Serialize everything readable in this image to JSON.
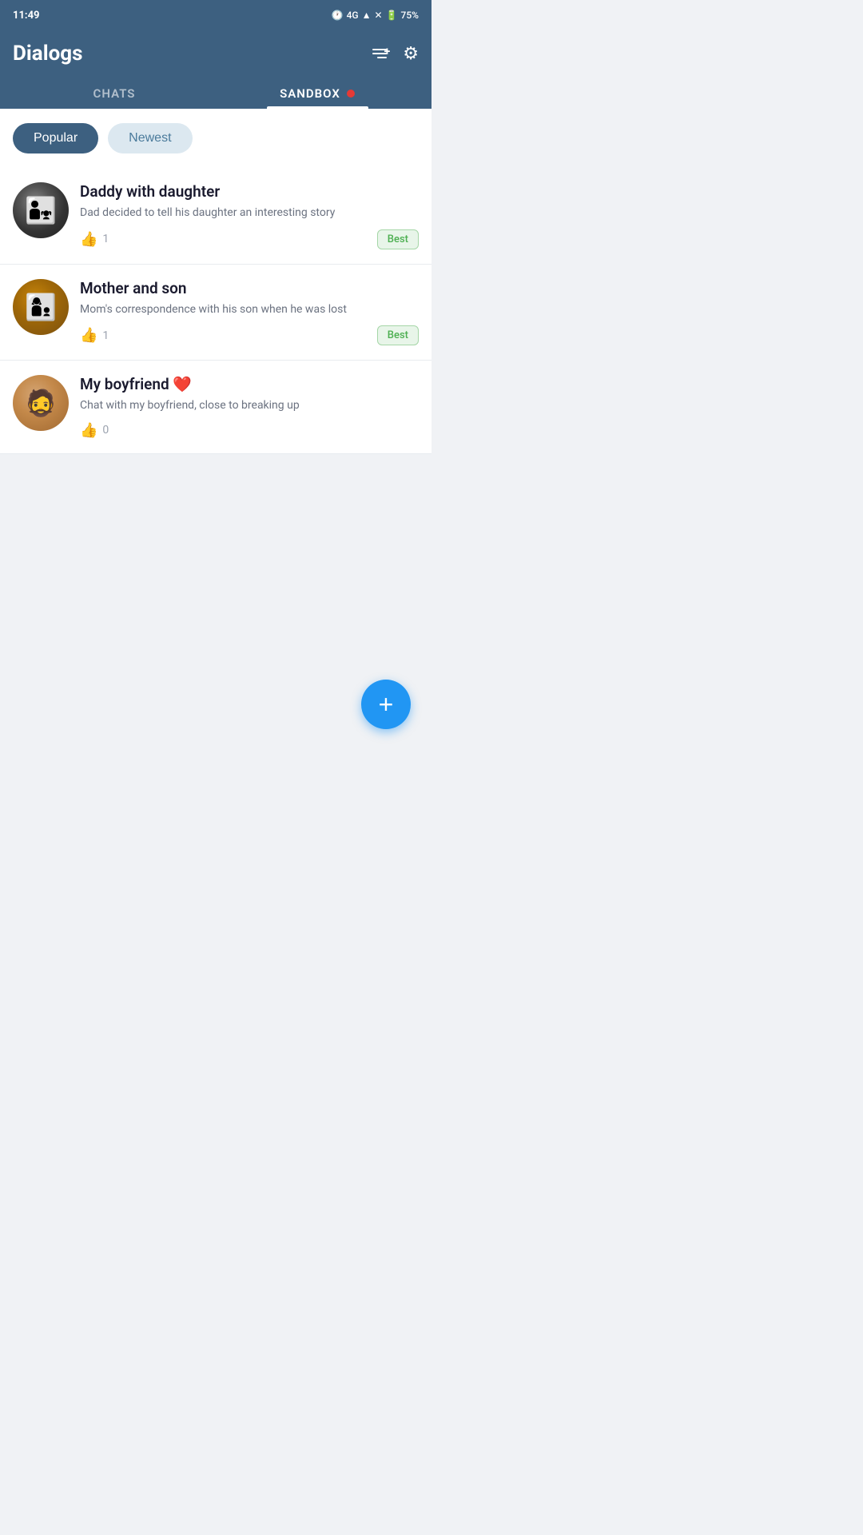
{
  "statusBar": {
    "time": "11:49",
    "battery": "75%",
    "network": "4G"
  },
  "header": {
    "title": "Dialogs",
    "addListIcon": "≡+",
    "settingsIcon": "⚙"
  },
  "tabs": [
    {
      "id": "chats",
      "label": "CHATS",
      "active": false
    },
    {
      "id": "sandbox",
      "label": "SANDBOX",
      "active": true,
      "hasDot": true
    }
  ],
  "filters": [
    {
      "id": "popular",
      "label": "Popular",
      "active": true
    },
    {
      "id": "newest",
      "label": "Newest",
      "active": false
    }
  ],
  "chats": [
    {
      "id": 1,
      "title": "Daddy with daughter",
      "description": "Dad decided to tell his daughter an interesting story",
      "likes": 1,
      "badge": "Best",
      "hasBadge": true,
      "avatarClass": "avatar-1"
    },
    {
      "id": 2,
      "title": "Mother and son",
      "description": "Mom's correspondence with his son when he was lost",
      "likes": 1,
      "badge": "Best",
      "hasBadge": true,
      "avatarClass": "avatar-2"
    },
    {
      "id": 3,
      "title": "My boyfriend",
      "titleEmoji": "❤️",
      "description": "Chat with my boyfriend, close to breaking up",
      "likes": 0,
      "badge": "",
      "hasBadge": false,
      "avatarClass": "avatar-3"
    }
  ],
  "fab": {
    "label": "+"
  }
}
